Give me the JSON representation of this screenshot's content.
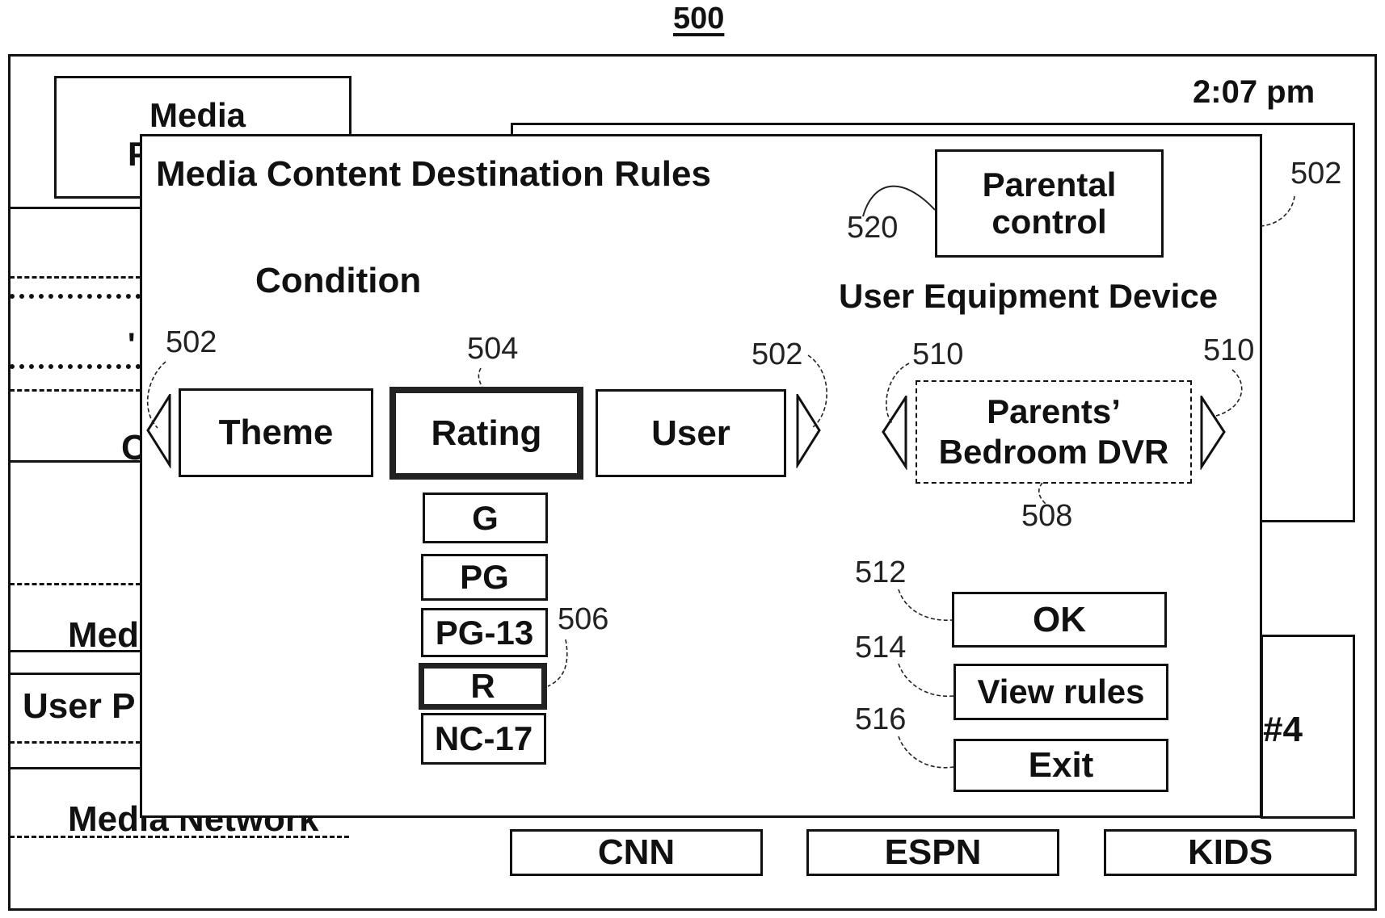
{
  "figure": {
    "number": "500"
  },
  "background": {
    "clock": "2:07 pm",
    "media_box_label_line1": "Media",
    "media_box_label_line2_partial": "P",
    "left_strip_partial_labels": [
      "'",
      "C",
      "Med",
      "User P",
      "Media Network"
    ],
    "right_box_partial_label": "#4",
    "channels": [
      "CNN",
      "ESPN",
      "KIDS"
    ],
    "panel_ref": "502"
  },
  "dialog": {
    "title": "Media Content Destination Rules",
    "condition_heading": "Condition",
    "condition_options": [
      {
        "label": "Theme",
        "selected": false
      },
      {
        "label": "Rating",
        "selected": true
      },
      {
        "label": "User",
        "selected": false
      }
    ],
    "rating_options": [
      {
        "label": "G",
        "selected": false
      },
      {
        "label": "PG",
        "selected": false
      },
      {
        "label": "PG-13",
        "selected": false
      },
      {
        "label": "R",
        "selected": true
      },
      {
        "label": "NC-17",
        "selected": false
      }
    ],
    "device_heading": "User Equipment Device",
    "device_selected_line1": "Parents’",
    "device_selected_line2": "Bedroom DVR",
    "parental_control_line1": "Parental",
    "parental_control_line2": "control",
    "buttons": {
      "ok": "OK",
      "view_rules": "View rules",
      "exit": "Exit"
    }
  },
  "reference_numerals": {
    "left_arrow": "502",
    "right_arrow": "502",
    "rating": "504",
    "r_option": "506",
    "device": "508",
    "device_left_arrow": "510",
    "device_right_arrow": "510",
    "ok": "512",
    "view_rules": "514",
    "exit": "516",
    "parental_control": "520"
  }
}
